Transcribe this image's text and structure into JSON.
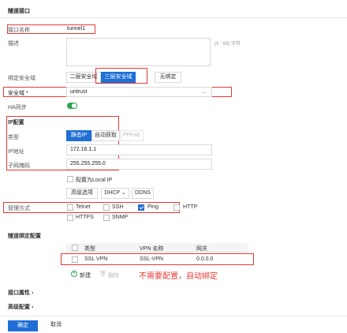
{
  "header": {
    "title": "隧道接口"
  },
  "fields": {
    "name_label": "接口名称",
    "name_value": "tunnel1",
    "desc_label": "描述",
    "desc_hint": "(0 - 63) 字符",
    "zone_bind_label": "绑定安全域",
    "zone_opts": [
      "二层安全域",
      "三层安全域",
      "无绑定"
    ],
    "security_zone_label": "安全域 *",
    "security_zone_value": "untrust",
    "ha_label": "HA同步"
  },
  "ip": {
    "section": "IP配置",
    "type_label": "类型",
    "type_opts": [
      "静态IP",
      "自动获取",
      "PPPoE"
    ],
    "ip_label": "IP地址",
    "ip_value": "172.16.1.1",
    "mask_label": "子网掩码",
    "mask_value": "255.255.255.0",
    "local_ip_label": "配置为Local IP",
    "adv_label": "高级选项",
    "dhcp_label": "DHCP ⌄",
    "ddns_label": "DDNS"
  },
  "mgmt": {
    "label": "管理方式",
    "opts": [
      "Telnet",
      "SSH",
      "Ping",
      "HTTP",
      "HTTPS",
      "SNMP"
    ]
  },
  "tunnel": {
    "section": "隧道绑定配置",
    "cols": [
      "类型",
      "VPN 名称",
      "网关"
    ],
    "row": [
      "SSL VPN",
      "SSL-VPN",
      "0.0.0.0"
    ],
    "new_label": "新建",
    "del_label": "删除",
    "annotation": "不需要配置，自动绑定"
  },
  "more": {
    "iface_attr": "接口属性 ›",
    "advanced": "高级配置 ›"
  },
  "footer": {
    "ok": "确定",
    "cancel": "取消"
  },
  "colors": {
    "accent": "#1f6fd6",
    "annotation": "#e53935",
    "toggle": "#2ea44f"
  }
}
